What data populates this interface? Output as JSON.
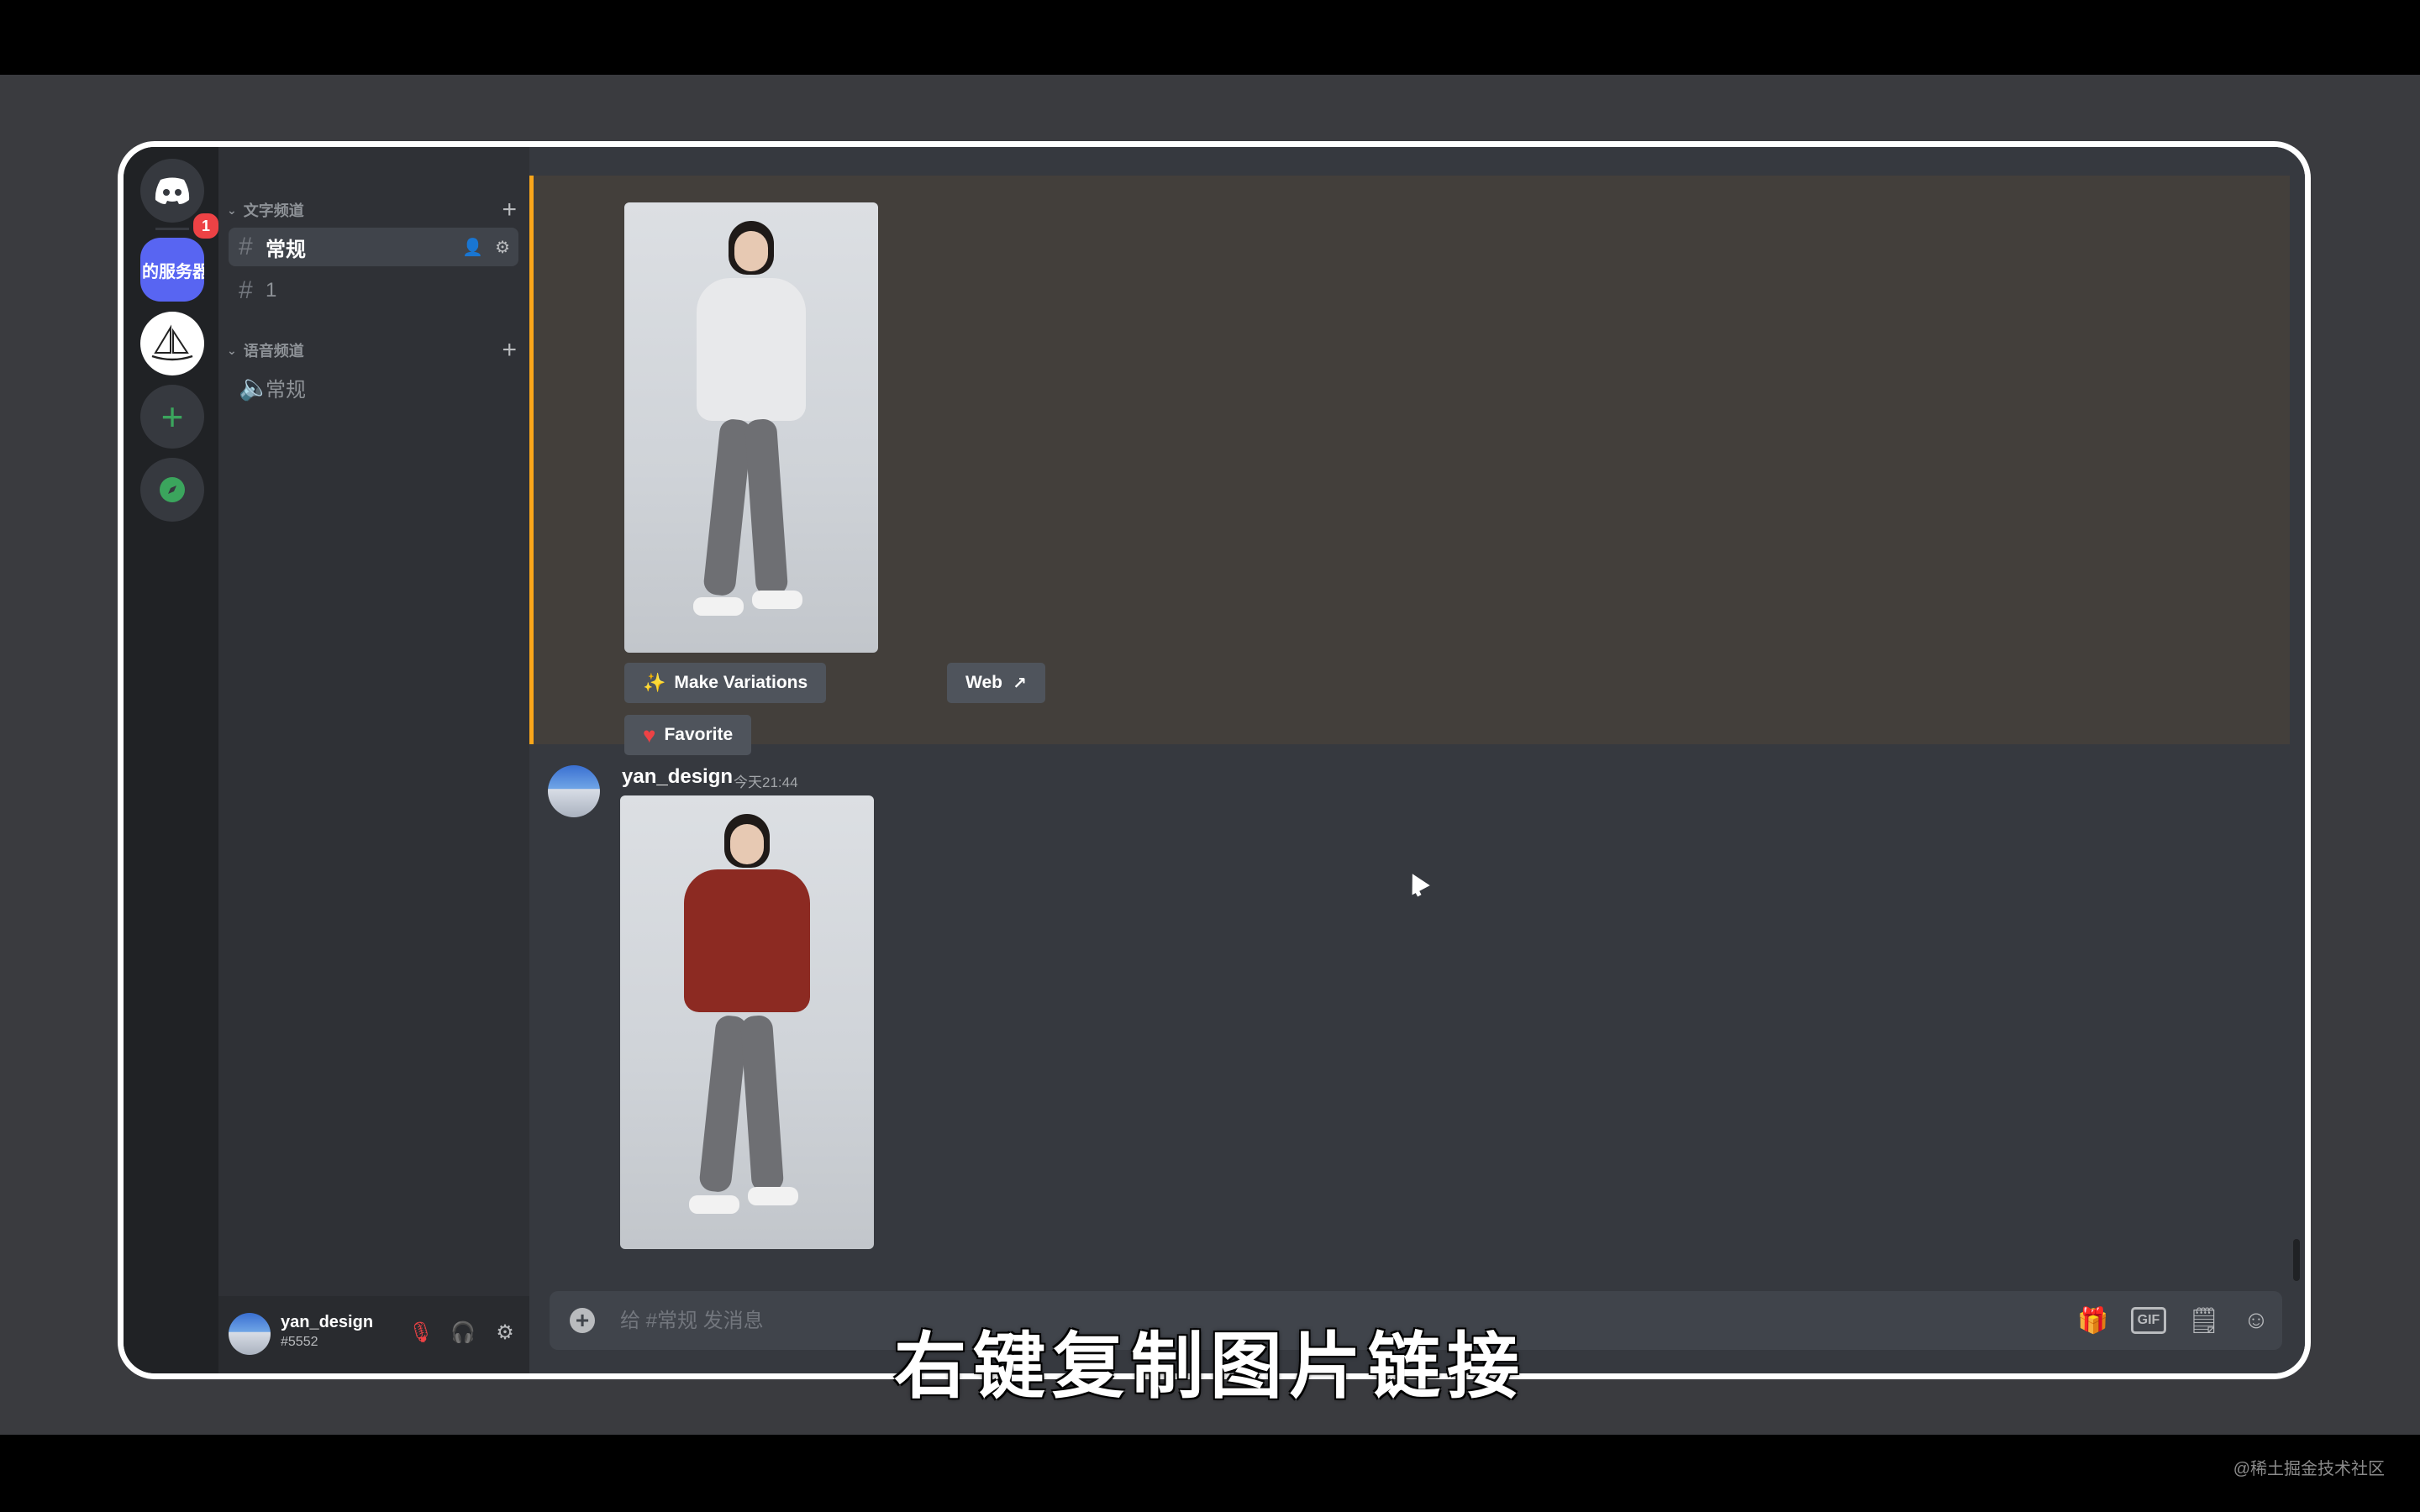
{
  "server_rail": {
    "home_badge": "1",
    "server1_label": "的服务器"
  },
  "channels": {
    "text_category": "文字频道",
    "voice_category": "语音频道",
    "text_channels": [
      {
        "name": "常规"
      },
      {
        "name": "1"
      }
    ],
    "voice_channels": [
      {
        "name": "常规"
      }
    ]
  },
  "user_panel": {
    "username": "yan_design",
    "tag": "#5552"
  },
  "messages": {
    "buttons": {
      "make_variations": "Make Variations",
      "web": "Web",
      "favorite": "Favorite"
    },
    "second": {
      "author": "yan_design",
      "time": "今天21:44"
    }
  },
  "composer": {
    "placeholder": "给 #常规 发消息",
    "gif_label": "GIF"
  },
  "subtitle": "右键复制图片链接",
  "watermark": "@稀土掘金技术社区",
  "colors": {
    "accent": "#5865f2",
    "highlight_border": "#faa61a",
    "highlight_bg": "#433f3b",
    "hoodie_gray": "#e8e9eb",
    "hoodie_red": "#8c2a22"
  }
}
